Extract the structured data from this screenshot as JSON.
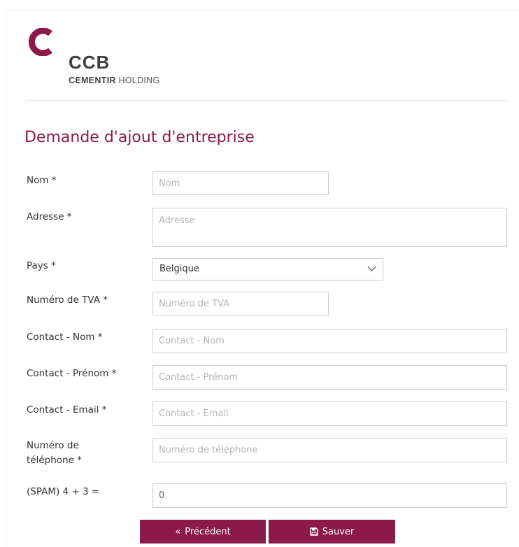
{
  "logo": {
    "brand": "CCB",
    "sub_bold": "CEMENTIR",
    "sub_rest": " HOLDING"
  },
  "title": "Demande d'ajout d'entreprise",
  "form": {
    "nom": {
      "label": "Nom *",
      "placeholder": "Nom"
    },
    "adresse": {
      "label": "Adresse *",
      "placeholder": "Adresse"
    },
    "pays": {
      "label": "Pays *",
      "value": "Belgique"
    },
    "tva": {
      "label": "Numéro de TVA *",
      "placeholder": "Numéro de TVA"
    },
    "contact_nom": {
      "label": "Contact - Nom *",
      "placeholder": "Contact - Nom"
    },
    "contact_prenom": {
      "label": "Contact - Prénom *",
      "placeholder": "Contact - Prénom"
    },
    "contact_email": {
      "label": "Contact - Email *",
      "placeholder": "Contact - Email"
    },
    "telephone": {
      "label_line1": "Numéro de",
      "label_line2": "téléphone *",
      "placeholder": "Numéro de téléphone"
    },
    "spam": {
      "label": "(SPAM) 4 + 3 =",
      "value": "0"
    }
  },
  "buttons": {
    "previous": {
      "icon": "«",
      "label": "Précédent"
    },
    "save": {
      "icon": "save-icon",
      "label": "Sauver"
    }
  },
  "colors": {
    "accent": "#8b1a4a"
  }
}
